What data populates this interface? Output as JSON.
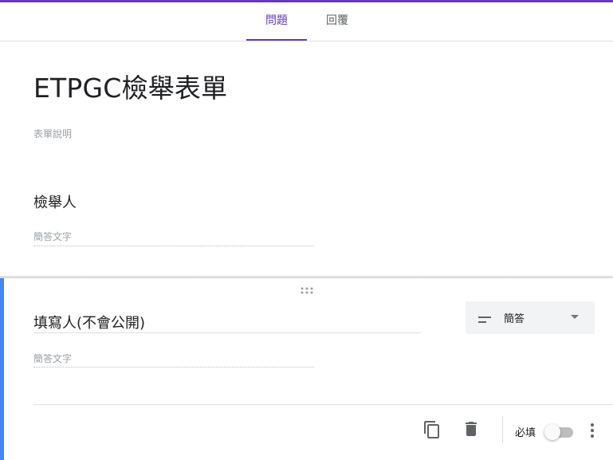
{
  "tabs": {
    "questions_label": "問題",
    "responses_label": "回覆",
    "active": "questions"
  },
  "form": {
    "title": "ETPGC檢舉表單",
    "description_placeholder": "表單說明"
  },
  "questions": [
    {
      "title": "檢舉人",
      "answer_placeholder": "簡答文字"
    },
    {
      "title": "填寫人(不會公開)",
      "answer_placeholder": "簡答文字",
      "type_label": "簡答",
      "required_label": "必填",
      "required": false
    }
  ],
  "icons": {
    "drag": "drag-handle-icon",
    "type": "short-answer-icon",
    "copy": "copy-icon",
    "delete": "delete-icon",
    "more": "more-vert-icon"
  },
  "colors": {
    "accent": "#673ab7",
    "active_card": "#4285f4"
  }
}
